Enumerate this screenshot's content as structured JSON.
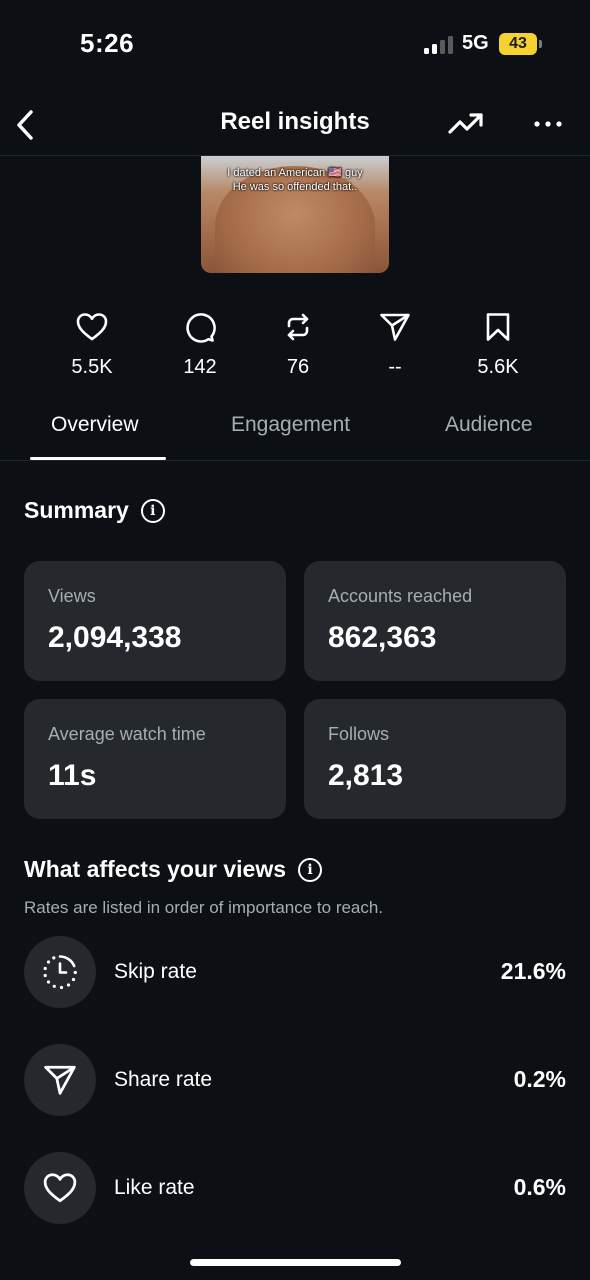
{
  "status_bar": {
    "time": "5:26",
    "network": "5G",
    "battery": "43"
  },
  "header": {
    "title": "Reel insights"
  },
  "reel": {
    "caption_line1": "I dated an American 🇺🇸 guy",
    "caption_line2": "He was so offended that.."
  },
  "stats": [
    {
      "icon": "heart-icon",
      "value": "5.5K"
    },
    {
      "icon": "comment-icon",
      "value": "142"
    },
    {
      "icon": "repost-icon",
      "value": "76"
    },
    {
      "icon": "send-icon",
      "value": "--"
    },
    {
      "icon": "bookmark-icon",
      "value": "5.6K"
    }
  ],
  "tabs": [
    {
      "label": "Overview",
      "active": true
    },
    {
      "label": "Engagement",
      "active": false
    },
    {
      "label": "Audience",
      "active": false
    }
  ],
  "summary": {
    "title": "Summary",
    "cards": [
      {
        "label": "Views",
        "value": "2,094,338"
      },
      {
        "label": "Accounts reached",
        "value": "862,363"
      },
      {
        "label": "Average watch time",
        "value": "11s"
      },
      {
        "label": "Follows",
        "value": "2,813"
      }
    ]
  },
  "views_factors": {
    "title": "What affects your views",
    "subtitle": "Rates are listed in order of importance to reach.",
    "metrics": [
      {
        "icon": "skip-timer-icon",
        "label": "Skip rate",
        "value": "21.6%"
      },
      {
        "icon": "send-icon",
        "label": "Share rate",
        "value": "0.2%"
      },
      {
        "icon": "heart-icon",
        "label": "Like rate",
        "value": "0.6%"
      }
    ]
  }
}
